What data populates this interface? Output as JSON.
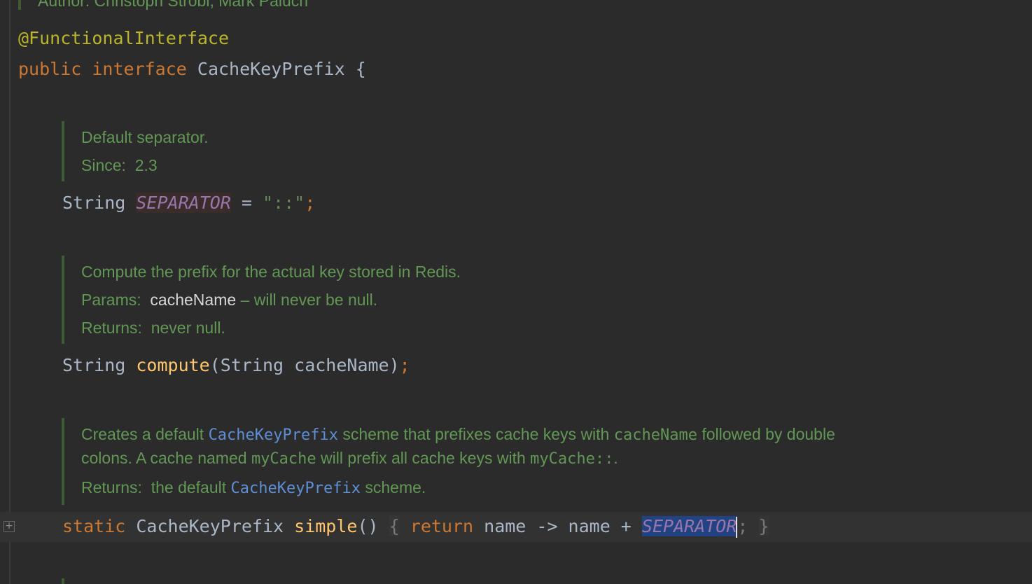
{
  "author_line": "Author: Christoph Strobl, Mark Paluch",
  "annotation": "@FunctionalInterface",
  "interface_decl": {
    "kw_public": "public",
    "kw_interface": "interface",
    "name": "CacheKeyPrefix",
    "brace": "{"
  },
  "doc1": {
    "description": "Default separator.",
    "since_label": "Since:",
    "since_value": "2.3"
  },
  "separator_decl": {
    "type": "String",
    "field": "SEPARATOR",
    "eq": "=",
    "value": "\"::\"",
    "semi": ";"
  },
  "doc2": {
    "description": "Compute the prefix for the actual key stored in Redis.",
    "params_label": "Params:",
    "param_name": "cacheName",
    "param_desc": "– will never be null.",
    "returns_label": "Returns:",
    "returns_value": "never null."
  },
  "compute_decl": {
    "type": "String",
    "method": "compute",
    "params": "(String cacheName)",
    "semi": ";"
  },
  "doc3": {
    "line1_a": "Creates a default ",
    "line1_link": "CacheKeyPrefix",
    "line1_b": " scheme that prefixes cache keys with ",
    "line1_code": "cacheName",
    "line1_c": " followed by double",
    "line2_a": "colons. A cache named ",
    "line2_code1": "myCache",
    "line2_b": " will prefix all cache keys with ",
    "line2_code2": "myCache::",
    "line2_c": ".",
    "returns_label": "Returns:",
    "returns_a": "the default ",
    "returns_link": "CacheKeyPrefix",
    "returns_b": " scheme."
  },
  "simple_decl": {
    "kw_static": "static",
    "type": "CacheKeyPrefix",
    "method": "simple",
    "parens": "()",
    "open_brace": "{",
    "kw_return": "return",
    "body": "name -> name + ",
    "field": "SEPARATOR",
    "semi": ";",
    "close_brace": "}"
  },
  "colors": {
    "background": "#2b2b2b",
    "keyword": "#cc7832",
    "annotation": "#bbb529",
    "field": "#9876aa",
    "method": "#ffc66d",
    "string": "#6a8759",
    "doc": "#629755",
    "doc_link": "#5e8fd4"
  }
}
